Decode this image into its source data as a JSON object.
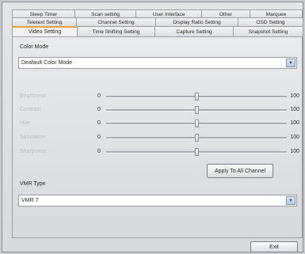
{
  "tabs": {
    "row1": [
      "Sleep Timer",
      "Scan setting",
      "User Interface",
      "Other",
      "Marquee"
    ],
    "row2": [
      "Teletext Setting",
      "Channel Setting",
      "Display Ratio Setting",
      "OSD Setting"
    ],
    "row3": [
      "Video Setting",
      "Time Shifting Setting",
      "Capture Setting",
      "Snapshot Setting"
    ]
  },
  "color_mode": {
    "label": "Color Mode",
    "value": "Deafault Color Mode"
  },
  "sliders": [
    {
      "name": "Brightness",
      "min": "0",
      "max": "100",
      "level": 0.5
    },
    {
      "name": "Contrast",
      "min": "0",
      "max": "100",
      "level": 0.5
    },
    {
      "name": "Hue",
      "min": "0",
      "max": "100",
      "level": 0.5
    },
    {
      "name": "Saturation",
      "min": "0",
      "max": "100",
      "level": 0.5
    },
    {
      "name": "Sharpness",
      "min": "0",
      "max": "100",
      "level": 0.5
    }
  ],
  "apply_button": "Apply To All Channel",
  "vmr": {
    "label": "VMR Type",
    "value": "VMR 7"
  },
  "exit_button": "Exit",
  "colors": {
    "active_tab_accent": "#e0a63a"
  }
}
